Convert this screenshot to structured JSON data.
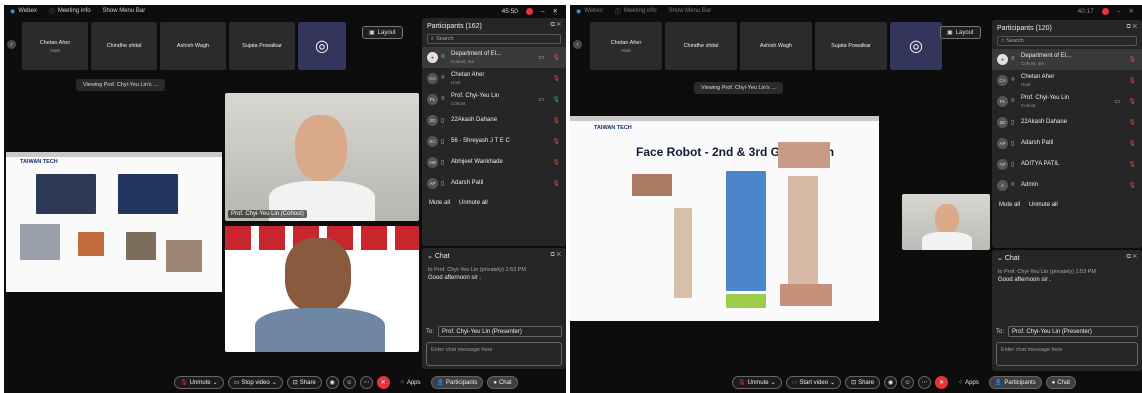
{
  "left": {
    "titlebar": {
      "app": "Webex",
      "meeting_info": "Meeting info",
      "menu": "Show Menu Bar",
      "time": "45:50"
    },
    "strip": [
      {
        "name": "Chetan Aher",
        "role": "Host"
      },
      {
        "name": "Chindhe shital",
        "role": ""
      },
      {
        "name": "Ashish Wagh",
        "role": ""
      },
      {
        "name": "Sujata Powalkar",
        "role": ""
      }
    ],
    "layout_label": "Layout",
    "viewing": "Viewing Prof. Chyi-Yeu Lin's ...",
    "slide_header": "TAIWAN TECH",
    "video_label": "Prof. Chyi-Yeu Lin (Cohost)",
    "participants": {
      "title": "Participants (162)",
      "search_placeholder": "Search",
      "items": [
        {
          "initials": "",
          "name": "Department of El...",
          "sub": "Cohost, me"
        },
        {
          "initials": "CA",
          "name": "Chetan Aher",
          "sub": "Host"
        },
        {
          "initials": "PL",
          "name": "Prof. Chyi-Yeu Lin",
          "sub": "Cohost"
        },
        {
          "initials": "2D",
          "name": "22Akash Dahane",
          "sub": ""
        },
        {
          "initials": "SC",
          "name": "56 - Shreyash J T E C",
          "sub": ""
        },
        {
          "initials": "AW",
          "name": "Abhijeet Wankhade",
          "sub": ""
        },
        {
          "initials": "AP",
          "name": "Adarsh Patil",
          "sub": ""
        }
      ],
      "mute_all": "Mute all",
      "unmute_all": "Unmute all"
    },
    "chat": {
      "title": "Chat",
      "meta": "to Prof. Chyi-Yeu Lin (privately)   1:53 PM",
      "message": "Good afternoon sir .",
      "to_label": "To:",
      "to_value": "Prof. Chyi-Yeu Lin (Presenter)",
      "placeholder": "Enter chat message here"
    },
    "toolbar": {
      "unmute": "Unmute",
      "stop_video": "Stop video",
      "share": "Share",
      "apps": "Apps",
      "participants": "Participants",
      "chat": "Chat"
    }
  },
  "right": {
    "titlebar": {
      "app": "Webex",
      "meeting_info": "Meeting info",
      "menu": "Show Menu Bar",
      "time": "40:17"
    },
    "strip": [
      {
        "name": "Chetan Aher",
        "role": "Host"
      },
      {
        "name": "Chindhe shital",
        "role": ""
      },
      {
        "name": "Ashish Wagh",
        "role": ""
      },
      {
        "name": "Sujata Powalkar",
        "role": ""
      }
    ],
    "layout_label": "Layout",
    "viewing": "Viewing Prof. Chyi-Yeu Lin's ...",
    "slide_header": "TAIWAN TECH",
    "slide_title": "Face Robot - 2nd & 3rd Generation",
    "participants": {
      "title": "Participants (120)",
      "search_placeholder": "Search",
      "items": [
        {
          "initials": "",
          "name": "Department of El...",
          "sub": "Cohost, me"
        },
        {
          "initials": "CA",
          "name": "Chetan Aher",
          "sub": "Host"
        },
        {
          "initials": "PL",
          "name": "Prof. Chyi-Yeu Lin",
          "sub": "Cohost"
        },
        {
          "initials": "2D",
          "name": "22Akash Dahane",
          "sub": ""
        },
        {
          "initials": "AP",
          "name": "Adarsh Patil",
          "sub": ""
        },
        {
          "initials": "AP",
          "name": "ADITYA PATIL",
          "sub": ""
        },
        {
          "initials": "A",
          "name": "Admin",
          "sub": ""
        }
      ],
      "mute_all": "Mute all",
      "unmute_all": "Unmute all"
    },
    "chat": {
      "title": "Chat",
      "meta": "to Prof. Chyi-Yeu Lin (privately)   1:53 PM",
      "message": "Good afternoon sir .",
      "to_label": "To:",
      "to_value": "Prof. Chyi-Yeu Lin (Presenter)",
      "placeholder": "Enter chat message here"
    },
    "toolbar": {
      "unmute": "Unmute",
      "start_video": "Start video",
      "share": "Share",
      "apps": "Apps",
      "participants": "Participants",
      "chat": "Chat"
    }
  },
  "icons": {
    "webex": "webex-icon",
    "info": "info-icon",
    "record": "record-icon",
    "minimize": "minimize-icon",
    "close": "close-icon",
    "mic_muted": "mic-muted-icon",
    "camera": "camera-icon",
    "share": "share-icon",
    "reactions": "reactions-icon",
    "more": "more-icon",
    "leave": "leave-icon",
    "apps": "apps-icon",
    "participants": "participants-icon",
    "chat": "chat-icon"
  },
  "colors": {
    "accent_red": "#e5343a",
    "panel": "#262626",
    "background": "#0d0d0d",
    "active_tile": "#33355a"
  }
}
